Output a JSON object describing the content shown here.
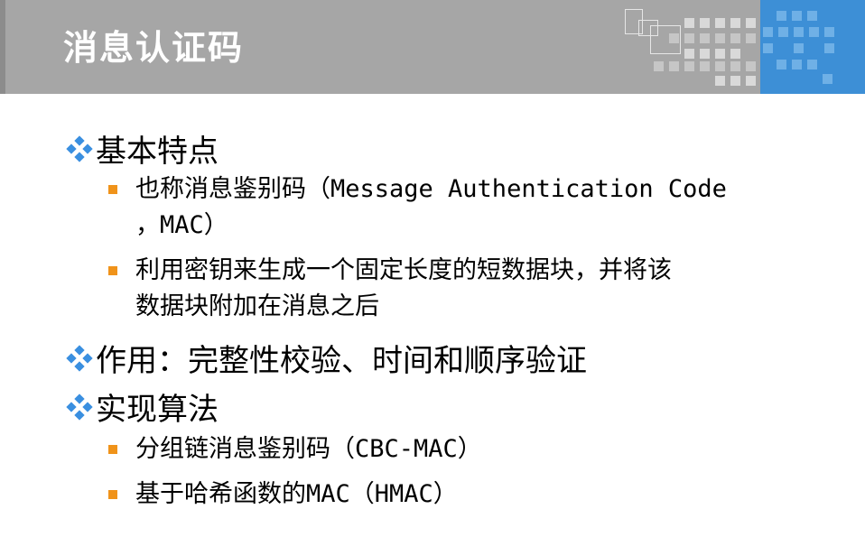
{
  "slide": {
    "title": "消息认证码",
    "items": [
      {
        "text": "基本特点",
        "subitems": [
          {
            "line1": "也称消息鉴别码（Message Authentication Code",
            "line2": "，MAC）"
          },
          {
            "line1": "利用密钥来生成一个固定长度的短数据块，并将该",
            "line2": "数据块附加在消息之后"
          }
        ]
      },
      {
        "text": "作用：完整性校验、时间和顺序验证",
        "subitems": []
      },
      {
        "text": "实现算法",
        "subitems": [
          {
            "line1": "分组链消息鉴别码（CBC-MAC）"
          },
          {
            "line1": "基于哈希函数的MAC（HMAC）"
          }
        ]
      }
    ]
  },
  "colors": {
    "header_bg": "#a6a6a6",
    "accent_blue": "#3d8fd6",
    "diamond_blue": "#3a8fe0",
    "bullet_orange": "#f0931a"
  }
}
